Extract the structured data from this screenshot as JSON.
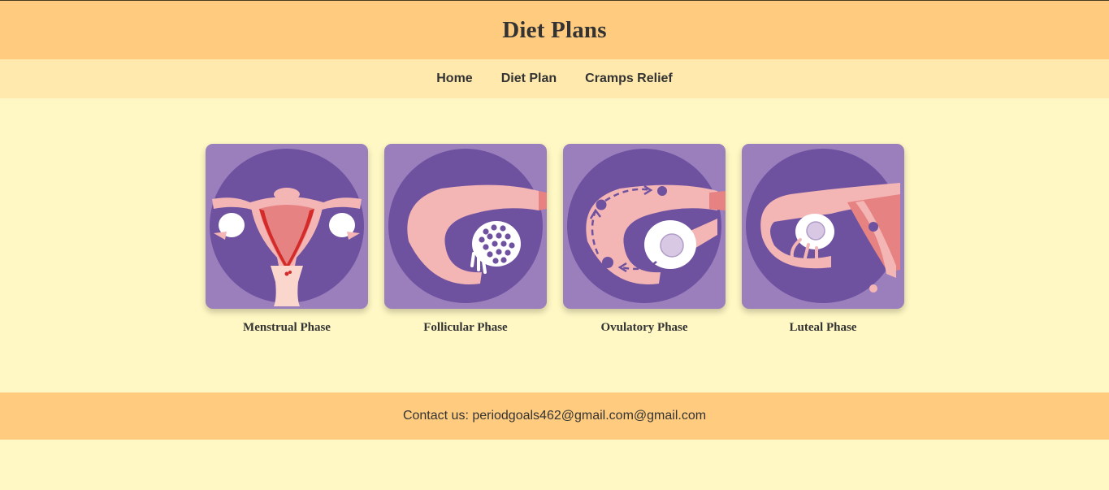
{
  "header": {
    "title": "Diet Plans"
  },
  "nav": {
    "items": [
      {
        "label": "Home"
      },
      {
        "label": "Diet Plan"
      },
      {
        "label": "Cramps Relief"
      }
    ]
  },
  "phases": [
    {
      "label": "Menstrual Phase",
      "icon": "uterus-illustration-icon"
    },
    {
      "label": "Follicular Phase",
      "icon": "follicle-illustration-icon"
    },
    {
      "label": "Ovulatory Phase",
      "icon": "ovulation-illustration-icon"
    },
    {
      "label": "Luteal Phase",
      "icon": "luteal-illustration-icon"
    }
  ],
  "footer": {
    "contact": "Contact us: periodgoals462@gmail.com@gmail.com"
  },
  "colors": {
    "header_bg": "#ffcb7f",
    "nav_bg": "#ffe9ad",
    "page_bg": "#fff8c4",
    "card_bg": "#9b7fbd",
    "circle": "#6e52a0",
    "pink": "#f4b5b5",
    "coral": "#e68282",
    "red": "#d42a2a"
  }
}
